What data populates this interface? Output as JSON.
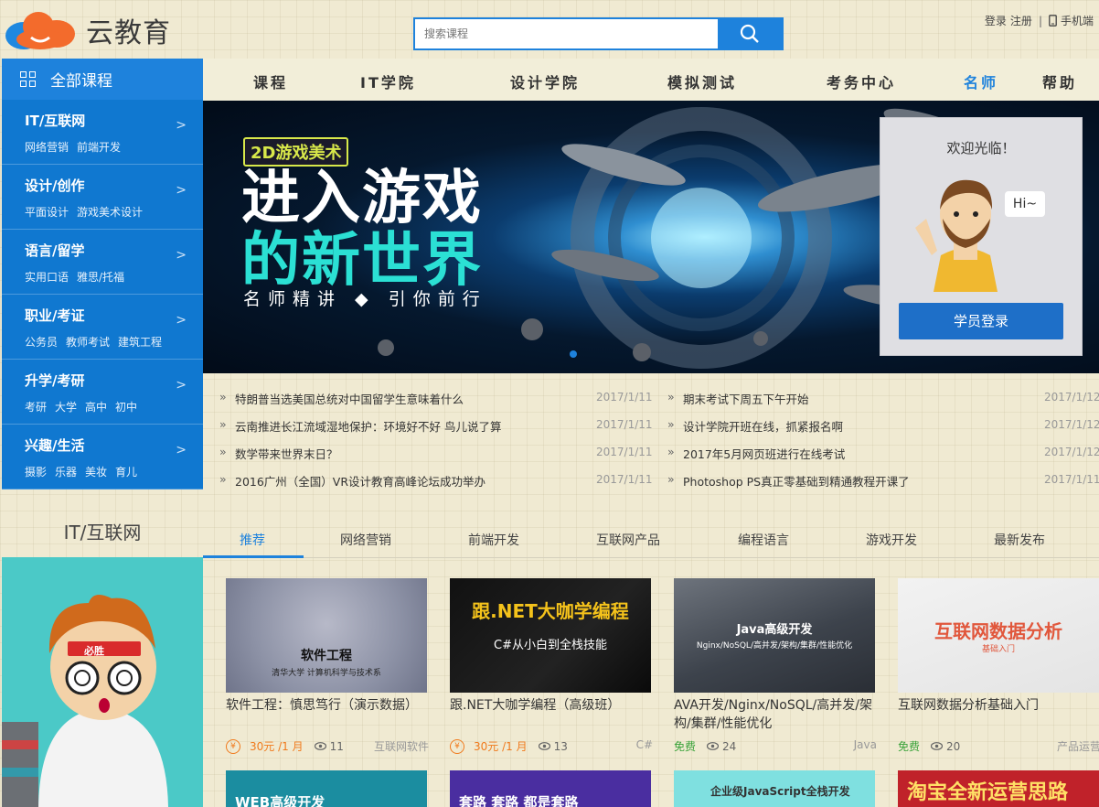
{
  "header": {
    "logo_text": "云教育",
    "search_placeholder": "搜索课程",
    "login": "登录",
    "register": "注册",
    "sep": "|",
    "mobile": "手机端"
  },
  "sidebar": {
    "all_courses": "全部课程",
    "categories": [
      {
        "title": "IT/互联网",
        "subs": [
          "网络营销",
          "前端开发"
        ]
      },
      {
        "title": "设计/创作",
        "subs": [
          "平面设计",
          "游戏美术设计"
        ]
      },
      {
        "title": "语言/留学",
        "subs": [
          "实用口语",
          "雅思/托福"
        ]
      },
      {
        "title": "职业/考证",
        "subs": [
          "公务员",
          "教师考试",
          "建筑工程"
        ]
      },
      {
        "title": "升学/考研",
        "subs": [
          "考研",
          "大学",
          "高中",
          "初中"
        ]
      },
      {
        "title": "兴趣/生活",
        "subs": [
          "摄影",
          "乐器",
          "美妆",
          "育儿"
        ]
      }
    ],
    "arrow": ">"
  },
  "nav": {
    "items": [
      "课程",
      "IT学院",
      "设计学院",
      "模拟测试",
      "考务中心",
      "名师",
      "帮助"
    ],
    "active_index": 5
  },
  "banner": {
    "tag": "2D游戏美术",
    "line1": "进入游戏",
    "line2": "的新世界",
    "slogan": "名师精讲 ◆ 引你前行"
  },
  "login_card": {
    "welcome": "欢迎光临！",
    "bubble": "Hi~",
    "button": "学员登录"
  },
  "news": {
    "bullet": "»",
    "left": [
      {
        "text": "特朗普当选美国总统对中国留学生意味着什么",
        "date": "2017/1/11"
      },
      {
        "text": "云南推进长江流域湿地保护：环境好不好 鸟儿说了算",
        "date": "2017/1/11"
      },
      {
        "text": "数学带来世界末日？",
        "date": "2017/1/11"
      },
      {
        "text": "2016广州（全国）VR设计教育高峰论坛成功举办",
        "date": "2017/1/11"
      }
    ],
    "right": [
      {
        "text": "期末考试下周五下午开始",
        "date": "2017/1/12"
      },
      {
        "text": "设计学院开班在线，抓紧报名啊",
        "date": "2017/1/12"
      },
      {
        "text": "2017年5月网页班进行在线考试",
        "date": "2017/1/12"
      },
      {
        "text": "Photoshop PS真正零基础到精通教程开课了",
        "date": "2017/1/11"
      }
    ]
  },
  "section": {
    "title": "IT/互联网",
    "tabs": [
      "推荐",
      "网络营销",
      "前端开发",
      "互联网产品",
      "编程语言",
      "游戏开发",
      "最新发布"
    ],
    "active_tab": 0,
    "promo_badge": "必胜"
  },
  "courses": [
    {
      "title": "软件工程：慎思笃行（演示数据）",
      "price": "30元 /1 月",
      "views": "11",
      "category": "互联网软件",
      "image_title": "软件工程",
      "image_sub": "清华大学 计算机科学与技术系",
      "paid": true
    },
    {
      "title": "跟.NET大咖学编程（高级班）",
      "price": "30元 /1 月",
      "views": "13",
      "category": "C#",
      "image_title": "跟.NET大咖学编程",
      "image_sub": "C#从小白到全栈技能",
      "paid": true
    },
    {
      "title": "AVA开发/Nginx/NoSQL/高并发/架构/集群/性能优化",
      "price": "免费",
      "views": "24",
      "category": "Java",
      "image_title": "Java高级开发",
      "image_sub": "Nginx/NoSQL/高并发/架构/集群/性能优化",
      "paid": false
    },
    {
      "title": "互联网数据分析基础入门",
      "price": "免费",
      "views": "20",
      "category": "产品运营",
      "image_title": "互联网数据分析",
      "image_sub": "基础入门",
      "paid": false
    }
  ],
  "bottom_cards": [
    {
      "text": "WEB高级开发"
    },
    {
      "text": "套路 套路 都是套路"
    },
    {
      "text": "企业级JavaScript全栈开发"
    },
    {
      "text": "淘宝全新运营思路"
    }
  ],
  "colors": {
    "accent": "#1e82dc",
    "sidebar": "#1078d0",
    "price": "#f07a1c",
    "free": "#3aa33a"
  }
}
